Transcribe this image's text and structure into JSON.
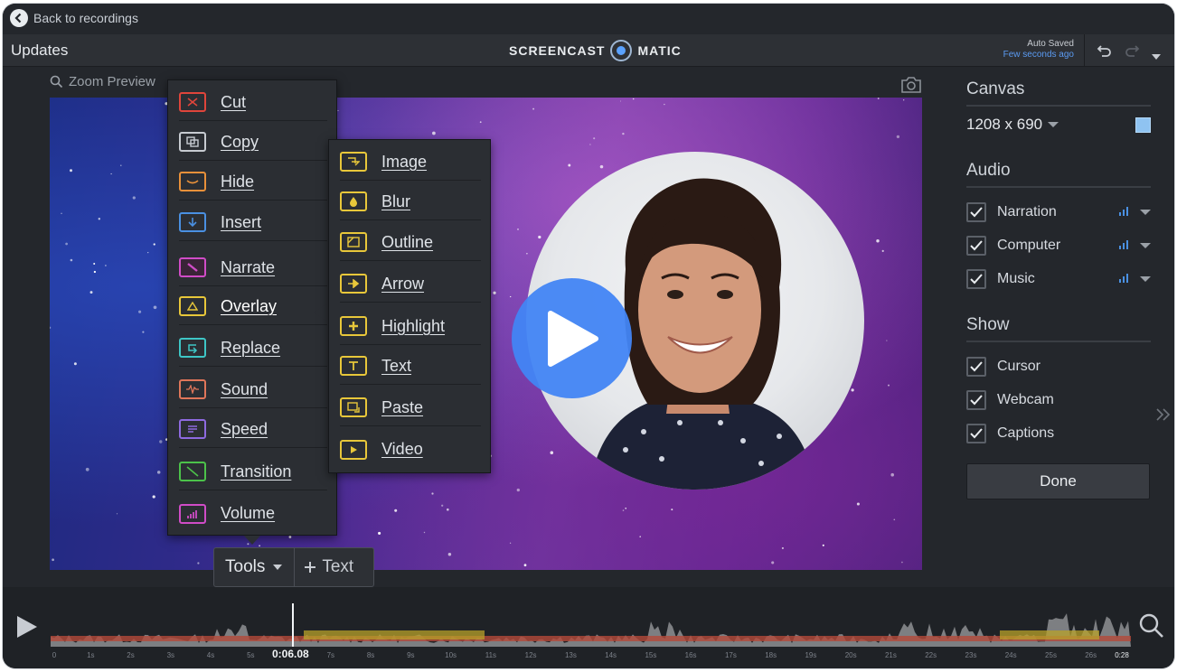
{
  "top": {
    "back_label": "Back to recordings"
  },
  "header": {
    "title": "Updates",
    "logo_left": "SCREENCAST",
    "logo_right": "MATIC",
    "autosave_line1": "Auto Saved",
    "autosave_line2": "Few seconds ago"
  },
  "preview": {
    "zoom_label": "Zoom Preview"
  },
  "tools_menu": {
    "items": [
      {
        "label": "Cut",
        "color": "#e0453b",
        "icon": "cut-icon"
      },
      {
        "label": "Copy",
        "color": "#c7cbd1",
        "icon": "copy-icon"
      },
      {
        "label": "Hide",
        "color": "#e8903a",
        "icon": "hide-icon"
      },
      {
        "label": "Insert",
        "color": "#4a90e2",
        "icon": "insert-icon"
      },
      {
        "label": "Narrate",
        "color": "#d04cc7",
        "icon": "narrate-icon"
      },
      {
        "label": "Overlay",
        "color": "#e8c73a",
        "icon": "overlay-icon"
      },
      {
        "label": "Replace",
        "color": "#3ec6c6",
        "icon": "replace-icon"
      },
      {
        "label": "Sound",
        "color": "#e0765a",
        "icon": "sound-icon"
      },
      {
        "label": "Speed",
        "color": "#8e6ae0",
        "icon": "speed-icon"
      },
      {
        "label": "Transition",
        "color": "#4cc24a",
        "icon": "transition-icon"
      },
      {
        "label": "Volume",
        "color": "#d04cc7",
        "icon": "volume-icon"
      }
    ]
  },
  "overlay_menu": {
    "items": [
      {
        "label": "Image",
        "icon": "image-icon"
      },
      {
        "label": "Blur",
        "icon": "blur-icon"
      },
      {
        "label": "Outline",
        "icon": "outline-icon"
      },
      {
        "label": "Arrow",
        "icon": "arrow-icon"
      },
      {
        "label": "Highlight",
        "icon": "highlight-icon"
      },
      {
        "label": "Text",
        "icon": "text-icon"
      },
      {
        "label": "Paste",
        "icon": "paste-icon"
      },
      {
        "label": "Video",
        "icon": "video-icon"
      }
    ],
    "color": "#e8c73a"
  },
  "toolbar": {
    "tools_label": "Tools",
    "text_label": "Text"
  },
  "panel": {
    "canvas_title": "Canvas",
    "canvas_size": "1208 x 690",
    "canvas_color": "#8fc3f1",
    "audio_title": "Audio",
    "audio": [
      {
        "label": "Narration",
        "checked": true
      },
      {
        "label": "Computer",
        "checked": true
      },
      {
        "label": "Music",
        "checked": true
      }
    ],
    "show_title": "Show",
    "show": [
      {
        "label": "Cursor",
        "checked": true
      },
      {
        "label": "Webcam",
        "checked": true
      },
      {
        "label": "Captions",
        "checked": true
      }
    ],
    "done_label": "Done"
  },
  "timeline": {
    "current_time": "0:06.08",
    "end_time": "0:28",
    "ticks": [
      "0",
      "1s",
      "2s",
      "3s",
      "4s",
      "5s",
      "6s",
      "7s",
      "8s",
      "9s",
      "10s",
      "11s",
      "12s",
      "13s",
      "14s",
      "15s",
      "16s",
      "17s",
      "18s",
      "19s",
      "20s",
      "21s",
      "22s",
      "23s",
      "24s",
      "25s",
      "26s",
      "0:28"
    ]
  }
}
